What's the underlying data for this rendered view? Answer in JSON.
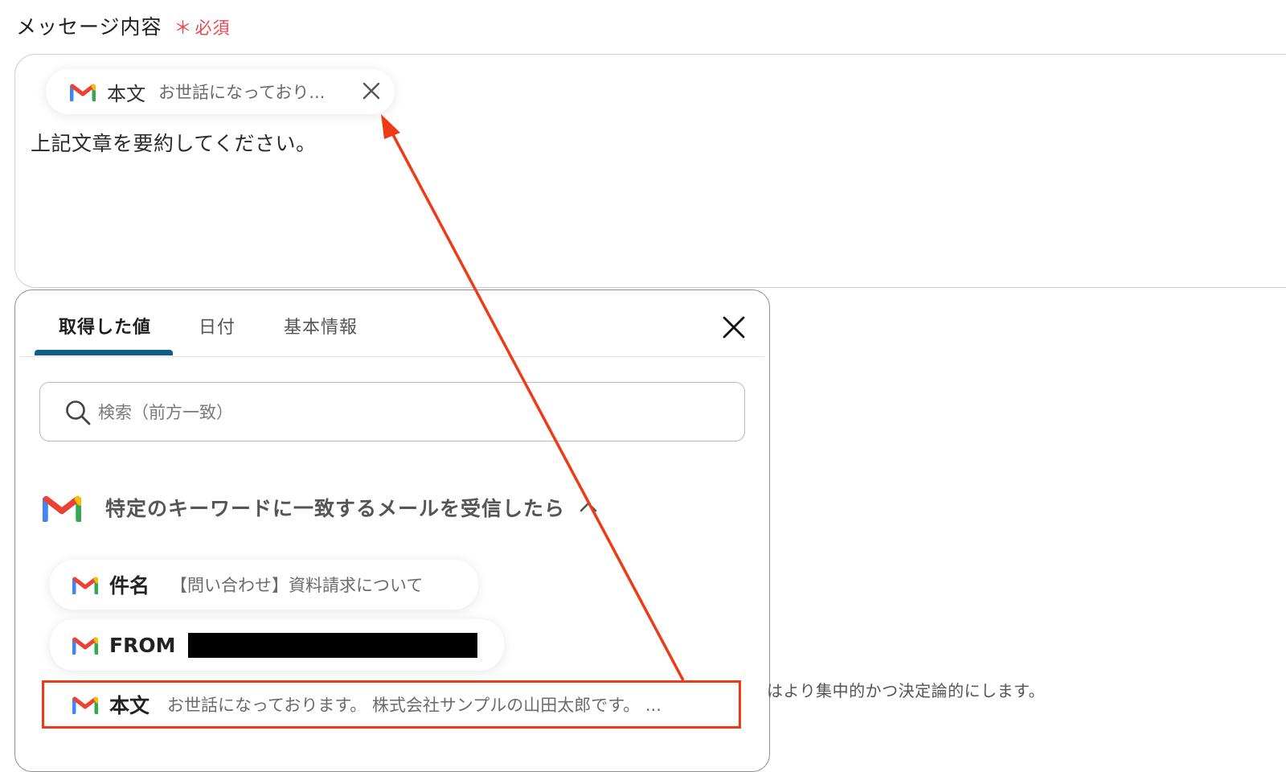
{
  "field": {
    "label": "メッセージ内容",
    "required_mark": "＊",
    "required_text": "必須"
  },
  "message": {
    "inserted_chip": {
      "key": "本文",
      "value": "お世話になっており...",
      "icon": "gmail-icon"
    },
    "text": "上記文章を要約してください。"
  },
  "picker": {
    "tabs": [
      {
        "label": "取得した値",
        "active": true
      },
      {
        "label": "日付",
        "active": false
      },
      {
        "label": "基本情報",
        "active": false
      }
    ],
    "search": {
      "placeholder": "検索（前方一致）",
      "value": ""
    },
    "trigger": {
      "icon": "gmail-icon",
      "label": "特定のキーワードに一致するメールを受信したら"
    },
    "items": [
      {
        "key": "件名",
        "value": "【問い合わせ】資料請求について"
      },
      {
        "key": "FROM",
        "value": ""
      },
      {
        "key": "本文",
        "value": "お世話になっております。 株式会社サンプルの山田太郎です。 ..."
      }
    ]
  },
  "background": {
    "partial_text": "はより集中的かつ決定論的にします。"
  },
  "annotation": {
    "color": "#ee3a16"
  },
  "colors": {
    "required": "#e8474e",
    "tab_active_underline": "#0f5e8a",
    "gmail_red": "#ea4335",
    "gmail_blue": "#4285f4",
    "gmail_green": "#34a853",
    "gmail_yellow": "#fbbc04"
  }
}
